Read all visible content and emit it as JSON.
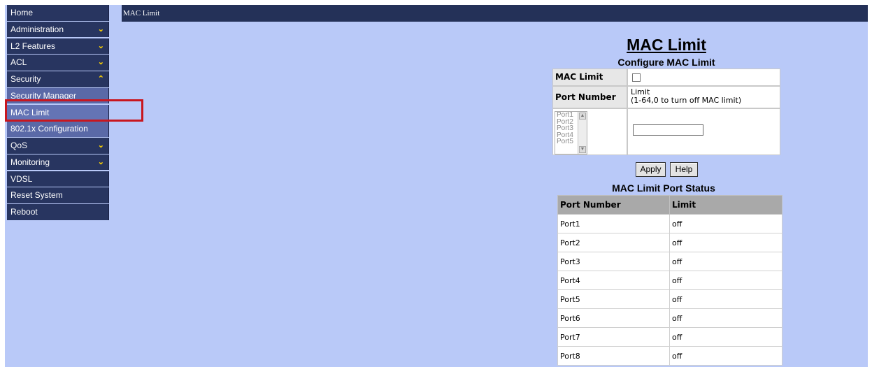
{
  "sidebar": {
    "items": [
      {
        "label": "Home",
        "chevron": ""
      },
      {
        "label": "Administration",
        "chevron": "⌄"
      },
      {
        "label": "L2 Features",
        "chevron": "⌄"
      },
      {
        "label": "ACL",
        "chevron": "⌄"
      },
      {
        "label": "Security",
        "chevron": "⌃"
      },
      {
        "label": "Security Manager",
        "chevron": ""
      },
      {
        "label": "MAC Limit",
        "chevron": ""
      },
      {
        "label": "802.1x Configuration",
        "chevron": ""
      },
      {
        "label": "QoS",
        "chevron": "⌄"
      },
      {
        "label": "Monitoring",
        "chevron": "⌄"
      },
      {
        "label": "VDSL",
        "chevron": ""
      },
      {
        "label": "Reset System",
        "chevron": ""
      },
      {
        "label": "Reboot",
        "chevron": ""
      }
    ]
  },
  "header": {
    "breadcrumb": "MAC Limit"
  },
  "main": {
    "title": "MAC Limit",
    "config_title": "Configure MAC Limit",
    "config": {
      "mac_limit_label": "MAC Limit",
      "port_number_label": "Port Number",
      "limit_hint_line1": "Limit",
      "limit_hint_line2": "(1-64,0 to turn off MAC limit)",
      "ports": [
        "Port1",
        "Port2",
        "Port3",
        "Port4",
        "Port5"
      ],
      "limit_value": ""
    },
    "buttons": {
      "apply": "Apply",
      "help": "Help"
    },
    "status_title": "MAC Limit Port Status",
    "status_headers": [
      "Port Number",
      "Limit"
    ],
    "status_rows": [
      [
        "Port1",
        "off"
      ],
      [
        "Port2",
        "off"
      ],
      [
        "Port3",
        "off"
      ],
      [
        "Port4",
        "off"
      ],
      [
        "Port5",
        "off"
      ],
      [
        "Port6",
        "off"
      ],
      [
        "Port7",
        "off"
      ],
      [
        "Port8",
        "off"
      ]
    ]
  },
  "colors": {
    "background": "#b9c9f8",
    "nav": "#283560",
    "nav_sub": "#5a69a7",
    "highlight": "#c8161f",
    "chevron": "#ffd400"
  }
}
